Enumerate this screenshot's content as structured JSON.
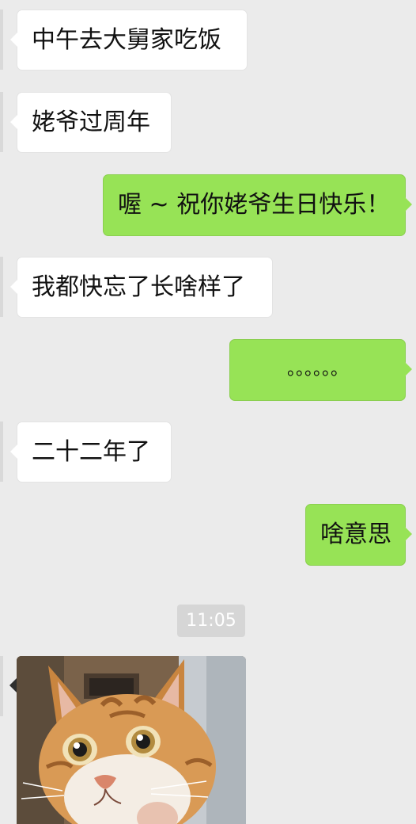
{
  "chat": {
    "messages": [
      {
        "side": "incoming",
        "text": "中午去大舅家吃饭"
      },
      {
        "side": "incoming",
        "text": "姥爷过周年"
      },
      {
        "side": "outgoing",
        "text": "喔 ~ 祝你姥爷生日快乐！"
      },
      {
        "side": "incoming",
        "text": "我都快忘了长啥样了"
      },
      {
        "side": "outgoing",
        "text": "。。。。。。"
      },
      {
        "side": "incoming",
        "text": "二十二年了"
      },
      {
        "side": "outgoing",
        "text": "啥意思"
      }
    ],
    "timestamp": "11:05",
    "image_message": {
      "subject": "cat-photo"
    }
  },
  "colors": {
    "background": "#ebebeb",
    "incoming_bubble": "#ffffff",
    "outgoing_bubble": "#97e356",
    "timestamp_pill": "#d6d6d6"
  }
}
